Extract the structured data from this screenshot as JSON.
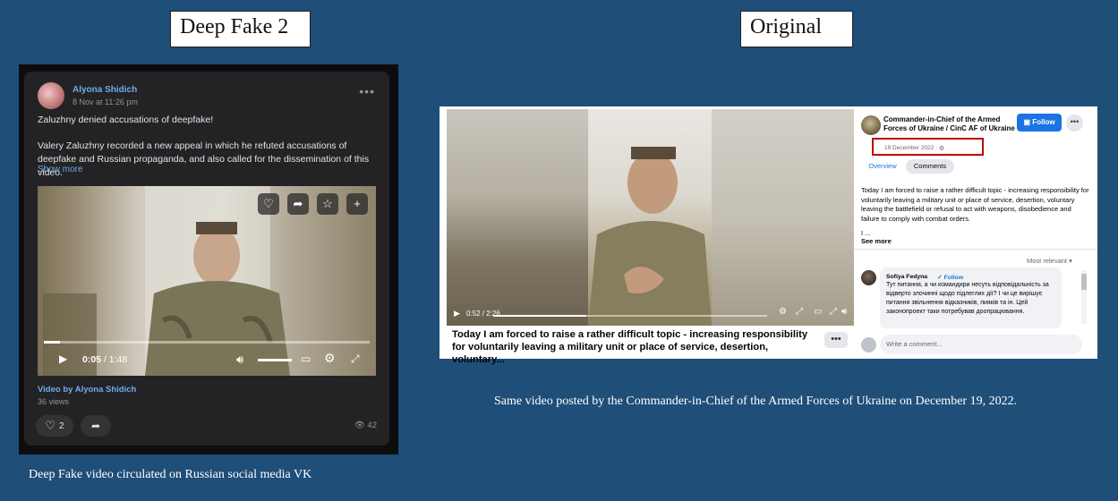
{
  "labels": {
    "deepfake_title": "Deep Fake 2",
    "original_title": "Original",
    "deepfake_caption": "Deep Fake video circulated on Russian social media VK",
    "original_caption": "Same video posted by the Commander-in-Chief of the Armed Forces of Ukraine on December 19, 2022."
  },
  "vk": {
    "author": "Alyona Shidich",
    "time": "8 Nov at 11:26 pm",
    "more_menu": "•••",
    "post_line1": "Zaluzhny denied accusations of deepfake!",
    "post_line2": "Valery Zaluzhny recorded a new appeal in which he refuted accusations of deepfake and Russian propaganda, and also called for the dissemination of this video.",
    "show_more": "Show more",
    "video": {
      "current_time": "0:05",
      "separator": " / ",
      "duration": "1:48",
      "progress_fraction": 0.05
    },
    "video_by": "Video by Alyona Shidich",
    "views": "36 views",
    "likes": "2",
    "eye_count": "42",
    "icons": [
      "heart-icon",
      "share-icon",
      "star-icon",
      "plus-icon",
      "play-icon",
      "volume-icon",
      "miniplayer-icon",
      "settings-icon",
      "fullscreen-icon",
      "eye-icon"
    ]
  },
  "fb": {
    "page_name": "Commander-in-Chief of the Armed Forces of Ukraine / CinC AF of Ukraine",
    "follow_label": "Follow",
    "more_label": "•••",
    "date": "19 December 2022 · ",
    "tabs": [
      {
        "label": "Overview",
        "active": false
      },
      {
        "label": "Comments",
        "active": true
      }
    ],
    "description": "Today I am forced to raise a rather difficult topic - increasing responsibility for voluntarily leaving a military unit or place of service, desertion, voluntary leaving the battlefield or refusal to act with weapons, disobedience and failure to comply with combat orders.",
    "description_tail": "I ...",
    "see_more": "See more",
    "sort_label": "Most relevant ▾",
    "comment": {
      "author": "Sofiya Fedyna",
      "follow": "Follow",
      "text": "Тут питання, а чи командири несуть відповідальність за відверто злочинні щодо підлеглих дії? І чи це вирішує питання звільнення відказників, пияків та ін. Цей законопроект таки потребував доопрацювання."
    },
    "write_placeholder": "Write a comment...",
    "video_time": "0:52 / 2:26",
    "progress_fraction": 0.34,
    "video_title": "Today I am forced to raise a rather difficult topic - increasing responsibility for voluntarily leaving a military unit or place of service, desertion, voluntary...",
    "title_more": "•••",
    "accent_color": "#1b74e4",
    "highlight_color": "#c00000"
  }
}
